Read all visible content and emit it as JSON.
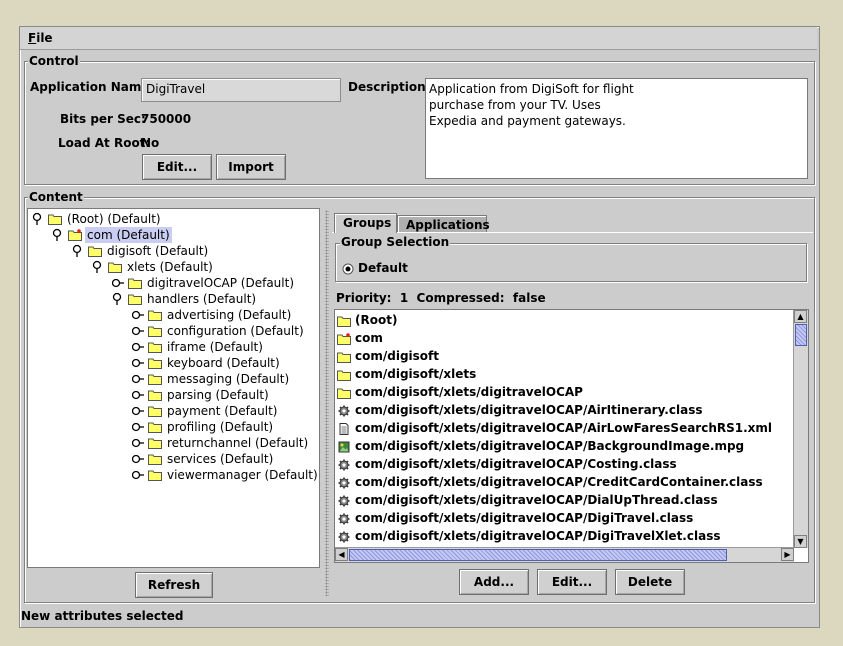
{
  "menu": {
    "file": "File",
    "file_mnemonic": "F",
    "file_rest": "ile"
  },
  "control": {
    "legend": "Control",
    "app_name_label": "Application Name:",
    "app_name_value": "DigiTravel",
    "bits_label": "Bits per Sec:",
    "bits_value": "750000",
    "load_root_label": "Load At Root:",
    "load_root_value": "No",
    "description_label": "Description:",
    "description_value": "Application from DigiSoft for flight\npurchase from your TV. Uses\nExpedia and payment gateways.",
    "edit_button": "Edit...",
    "import_button": "Import"
  },
  "content": {
    "legend": "Content",
    "refresh_button": "Refresh",
    "tree": [
      {
        "label": "(Root) (Default)",
        "depth": 0,
        "expanded": true
      },
      {
        "label": "com (Default)",
        "depth": 1,
        "expanded": true,
        "selected": true,
        "marked": true
      },
      {
        "label": "digisoft (Default)",
        "depth": 2,
        "expanded": true
      },
      {
        "label": "xlets (Default)",
        "depth": 3,
        "expanded": true
      },
      {
        "label": "digitravelOCAP (Default)",
        "depth": 4,
        "expanded": false
      },
      {
        "label": "handlers (Default)",
        "depth": 4,
        "expanded": true
      },
      {
        "label": "advertising (Default)",
        "depth": 5,
        "expanded": false
      },
      {
        "label": "configuration (Default)",
        "depth": 5,
        "expanded": false
      },
      {
        "label": "iframe (Default)",
        "depth": 5,
        "expanded": false
      },
      {
        "label": "keyboard (Default)",
        "depth": 5,
        "expanded": false
      },
      {
        "label": "messaging (Default)",
        "depth": 5,
        "expanded": false
      },
      {
        "label": "parsing (Default)",
        "depth": 5,
        "expanded": false
      },
      {
        "label": "payment (Default)",
        "depth": 5,
        "expanded": false
      },
      {
        "label": "profiling (Default)",
        "depth": 5,
        "expanded": false
      },
      {
        "label": "returnchannel (Default)",
        "depth": 5,
        "expanded": false
      },
      {
        "label": "services (Default)",
        "depth": 5,
        "expanded": false
      },
      {
        "label": "viewermanager (Default)",
        "depth": 5,
        "expanded": false
      }
    ],
    "tabs": [
      {
        "label": "Groups",
        "active": true
      },
      {
        "label": "Applications",
        "active": false
      }
    ],
    "group_selection": {
      "legend": "Group Selection",
      "option": "Default"
    },
    "priority_label": "Priority:",
    "priority_value": "1",
    "compressed_label": "Compressed:",
    "compressed_value": "false",
    "files": [
      {
        "name": "(Root)",
        "icon": "folder"
      },
      {
        "name": "com",
        "icon": "folder-marked"
      },
      {
        "name": "com/digisoft",
        "icon": "folder"
      },
      {
        "name": "com/digisoft/xlets",
        "icon": "folder"
      },
      {
        "name": "com/digisoft/xlets/digitravelOCAP",
        "icon": "folder"
      },
      {
        "name": "com/digisoft/xlets/digitravelOCAP/AirItinerary.class",
        "icon": "gear"
      },
      {
        "name": "com/digisoft/xlets/digitravelOCAP/AirLowFaresSearchRS1.xml",
        "icon": "document"
      },
      {
        "name": "com/digisoft/xlets/digitravelOCAP/BackgroundImage.mpg",
        "icon": "image"
      },
      {
        "name": "com/digisoft/xlets/digitravelOCAP/Costing.class",
        "icon": "gear"
      },
      {
        "name": "com/digisoft/xlets/digitravelOCAP/CreditCardContainer.class",
        "icon": "gear"
      },
      {
        "name": "com/digisoft/xlets/digitravelOCAP/DialUpThread.class",
        "icon": "gear"
      },
      {
        "name": "com/digisoft/xlets/digitravelOCAP/DigiTravel.class",
        "icon": "gear"
      },
      {
        "name": "com/digisoft/xlets/digitravelOCAP/DigiTravelXlet.class",
        "icon": "gear"
      }
    ],
    "add_button": "Add...",
    "edit_button": "Edit...",
    "delete_button": "Delete"
  },
  "status": "New attributes selected"
}
